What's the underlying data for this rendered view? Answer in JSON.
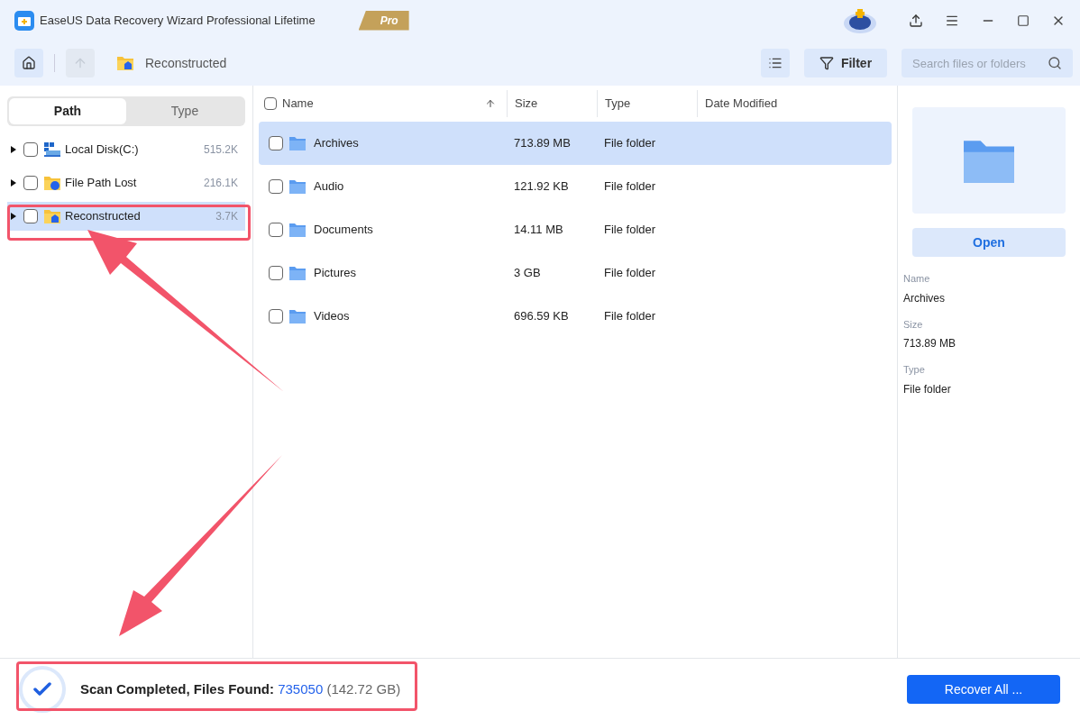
{
  "window": {
    "title": "EaseUS Data Recovery Wizard Professional Lifetime",
    "badge": "Pro"
  },
  "toolbar": {
    "location": "Reconstructed",
    "filter": "Filter",
    "search": {
      "placeholder": "Search files or folders"
    }
  },
  "sidebar": {
    "tabs": [
      {
        "label": "Path",
        "selected": true
      },
      {
        "label": "Type",
        "selected": false
      }
    ],
    "items": [
      {
        "label": "Local Disk(C:)",
        "count": "515.2K",
        "kind": "disk",
        "selected": false,
        "checked": false
      },
      {
        "label": "File Path Lost",
        "count": "216.1K",
        "kind": "lost",
        "selected": false,
        "checked": false
      },
      {
        "label": "Reconstructed",
        "count": "3.7K",
        "kind": "tag",
        "selected": true,
        "checked": false
      }
    ]
  },
  "table": {
    "all_checked": false,
    "columns": [
      "Name",
      "Size",
      "Type",
      "Date Modified"
    ],
    "rows": [
      {
        "name": "Archives",
        "size": "713.89 MB",
        "type": "File folder",
        "selected": true,
        "checked": false
      },
      {
        "name": "Audio",
        "size": "121.92 KB",
        "type": "File folder",
        "selected": false,
        "checked": false
      },
      {
        "name": "Documents",
        "size": "14.11 MB",
        "type": "File folder",
        "selected": false,
        "checked": false
      },
      {
        "name": "Pictures",
        "size": "3 GB",
        "type": "File folder",
        "selected": false,
        "checked": false
      },
      {
        "name": "Videos",
        "size": "696.59 KB",
        "type": "File folder",
        "selected": false,
        "checked": false
      }
    ]
  },
  "preview": {
    "open": "Open",
    "fields": [
      {
        "label": "Name",
        "value": "Archives"
      },
      {
        "label": "Size",
        "value": "713.89 MB"
      },
      {
        "label": "Type",
        "value": "File folder"
      }
    ]
  },
  "status_bar": {
    "text": "Scan Completed, Files Found: ",
    "count": "735050",
    "size": "(142.72 GB)",
    "recover": "Recover All ..."
  }
}
